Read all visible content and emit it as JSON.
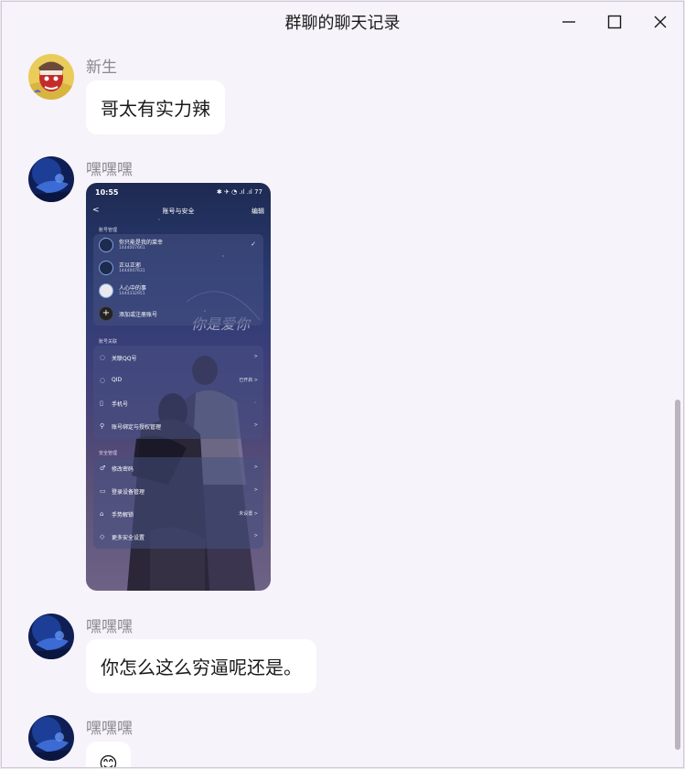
{
  "window": {
    "title": "群聊的聊天记录",
    "minimize_icon": "minimize-icon",
    "maximize_icon": "maximize-icon",
    "close_icon": "close-icon"
  },
  "messages": [
    {
      "sender": "新生",
      "text": "哥太有实力辣"
    },
    {
      "sender": "嘿嘿嘿",
      "image": "phone-screenshot"
    },
    {
      "sender": "嘿嘿嘿",
      "text": "你怎么这么穷逼呢还是。"
    },
    {
      "sender": "嘿嘿嘿",
      "text": "😊"
    }
  ],
  "phone_screenshot": {
    "time": "10:55",
    "status_right": "✱ ✈ ◔ .ıl .ıl 77",
    "nav_back": "<",
    "nav_title": "账号与安全",
    "nav_edit": "编辑",
    "section_accounts": "账号管理",
    "accounts": [
      {
        "name": "你只能是我的菜幸",
        "id": "1444007661",
        "checked": "✓"
      },
      {
        "name": "正以正邪",
        "id": "1444007631",
        "checked": ""
      },
      {
        "name": "人心中的事",
        "id": "1444332951",
        "checked": ""
      }
    ],
    "add_account": "添加或注册账号",
    "section_link": "账号关联",
    "link_items": [
      {
        "label": "关联QQ号",
        "right": ">"
      },
      {
        "label": "QID",
        "right": "已开启 >"
      },
      {
        "label": "手机号",
        "right": ""
      },
      {
        "label": "账号绑定与授权管理",
        "right": ">"
      }
    ],
    "section_security": "安全管理",
    "security_items": [
      {
        "label": "修改密码",
        "right": ">"
      },
      {
        "label": "登录设备管理",
        "right": ">"
      },
      {
        "label": "手势解锁",
        "right": "未设置 >"
      },
      {
        "label": "更多安全设置",
        "right": ">"
      }
    ]
  }
}
